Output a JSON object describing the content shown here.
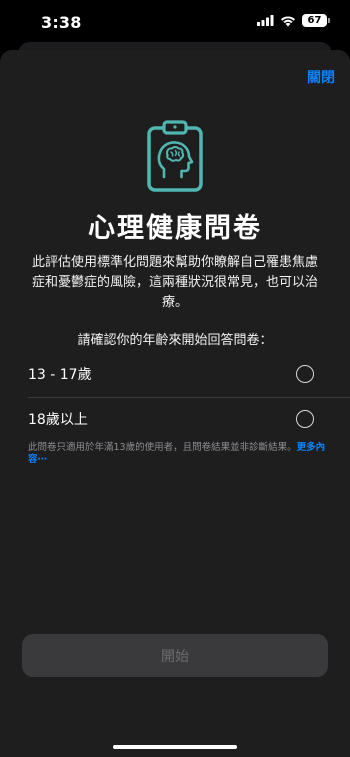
{
  "status_bar": {
    "time": "3:38",
    "battery": "67",
    "icons": [
      "signal-icon",
      "wifi-icon",
      "battery-icon"
    ]
  },
  "header": {
    "close_label": "關閉"
  },
  "hero": {
    "icon": "clipboard-brain-icon",
    "icon_color": "#4fb6b0"
  },
  "title": "心理健康問卷",
  "description": "此評估使用標準化問題來幫助你瞭解自己罹患焦慮症和憂鬱症的風險，這兩種狀況很常見，也可以治療。",
  "prompt": "請確認你的年齡來開始回答問卷：",
  "options": [
    {
      "label": "13 - 17歲",
      "selected": false
    },
    {
      "label": "18歲以上",
      "selected": false
    }
  ],
  "disclaimer": {
    "text": "此問卷只適用於年滿13歲的使用者，且問卷結果並非診斷結果。",
    "more_label": "更多內容⋯"
  },
  "start_button": {
    "label": "開始",
    "enabled": false
  },
  "colors": {
    "accent": "#0a84ff",
    "sheet_bg": "#1e1e1f",
    "button_disabled": "#3a3a3c"
  }
}
